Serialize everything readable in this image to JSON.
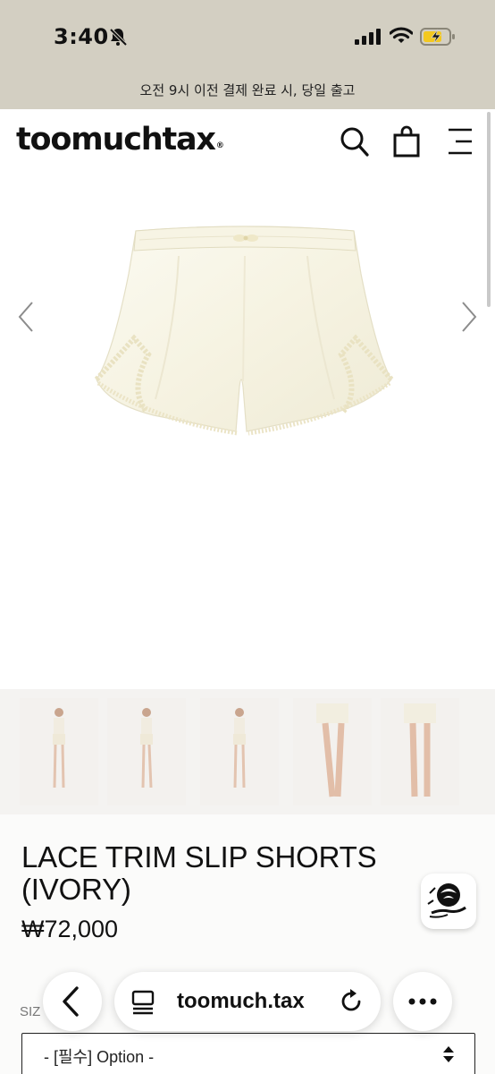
{
  "status_bar": {
    "time": "3:40",
    "icons": [
      "bell-slash-icon",
      "cellular-signal-icon",
      "wifi-icon",
      "battery-charging-icon"
    ]
  },
  "notice": {
    "text": "오전 9시 이전 결제 완료 시, 당일 출고"
  },
  "header": {
    "logo": "toomuchtax",
    "logo_mark": "®",
    "icons": [
      "search-icon",
      "shopping-bag-icon",
      "menu-icon"
    ]
  },
  "gallery": {
    "prev_icon": "chevron-left-icon",
    "next_icon": "chevron-right-icon"
  },
  "thumbnails": [
    {
      "alt": "full-body-front-ivory-set"
    },
    {
      "alt": "full-body-side-ivory-set"
    },
    {
      "alt": "full-body-front-ivory-set"
    },
    {
      "alt": "legs-shorts-front"
    },
    {
      "alt": "legs-shorts-back"
    }
  ],
  "product": {
    "title": "LACE TRIM SLIP SHORTS (IVORY)",
    "price": "₩72,000",
    "size_label": "SIZ",
    "option_placeholder": "- [필수] Option -"
  },
  "browser": {
    "url": "toomuch.tax",
    "icons": [
      "back-arrow-icon",
      "tabs-icon",
      "reload-icon",
      "more-icon"
    ]
  },
  "colors": {
    "top_zone": "#d3cfc2",
    "fabric": "#f8f6ea",
    "text": "#111111"
  }
}
